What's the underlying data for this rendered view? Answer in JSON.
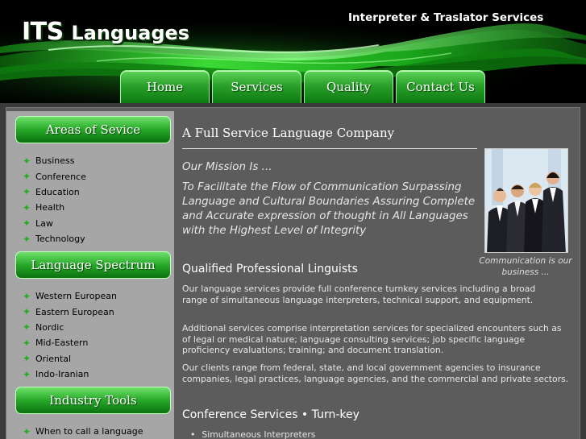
{
  "header": {
    "logo_its": "ITS",
    "logo_languages": "Languages",
    "tagline": "Interpreter & Traslator Services",
    "accent_color": "#2aa12a"
  },
  "nav": {
    "tabs": [
      {
        "label": "Home"
      },
      {
        "label": "Services"
      },
      {
        "label": "Quality"
      },
      {
        "label": "Contact Us"
      }
    ]
  },
  "sidebar": {
    "areas_heading": "Areas of Sevice",
    "areas": [
      "Business",
      "Conference",
      "Education",
      "Health",
      "Law",
      "Technology"
    ],
    "spectrum_heading": "Language Spectrum",
    "spectrum": [
      "Western European",
      "Eastern European",
      "Nordic",
      "Mid-Eastern",
      "Oriental",
      "Indo-Iranian"
    ],
    "tools_heading": "Industry Tools",
    "tools": [
      "When to call a language"
    ],
    "bullet_icon": "green-star-icon"
  },
  "main": {
    "title": "A Full Service Language Company",
    "mission_heading": "Our Mission Is ...",
    "mission_text": "To Facilitate the Flow of Communication Surpassing Language and Cultural Boundaries Assuring Complete and Accurate expression of thought in All Languages with the Highest Level of Integrity",
    "photo_caption": "Communication is our business ...",
    "qualified_heading": "Qualified Professional Linguists",
    "paragraphs": [
      "Our language services provide full conference turnkey services including a broad range of simultaneous language interpreters, technical support, and equipment.",
      "Additional services comprise interpretation services for specialized encounters such as of legal or medical nature; language consulting services; job specific language proficiency evaluations; training; and document translation.",
      "Our clients range from federal, state, and local government agencies to insurance companies, legal practices, language agencies, and the commercial and private sectors."
    ],
    "conference_heading": "Conference Services • Turn-key",
    "conference_items": [
      "Simultaneous Interpreters"
    ]
  }
}
